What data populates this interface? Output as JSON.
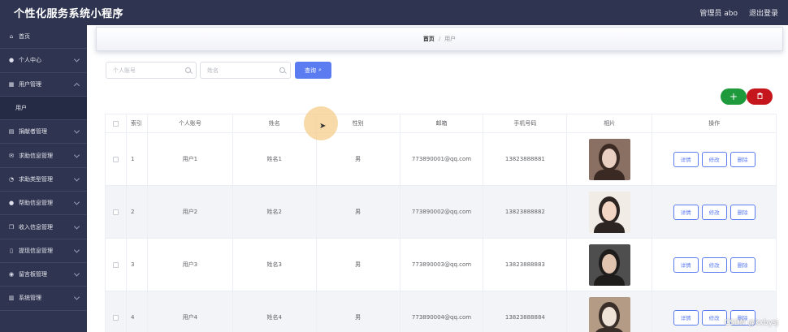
{
  "app": {
    "title": "个性化服务系统小程序"
  },
  "header": {
    "user_label": "管理员 abo",
    "logout": "退出登录"
  },
  "sidebar": {
    "items": [
      {
        "label": "首页",
        "icon": "home-icon",
        "glyph": "⌂"
      },
      {
        "label": "个人中心",
        "icon": "user-icon",
        "glyph": "●"
      },
      {
        "label": "用户管理",
        "icon": "building-icon",
        "glyph": "▦",
        "expanded": true
      },
      {
        "label": "捐献者管理",
        "icon": "grid-icon",
        "glyph": "▤"
      },
      {
        "label": "求助信息管理",
        "icon": "mail-icon",
        "glyph": "✉"
      },
      {
        "label": "求助类型管理",
        "icon": "compass-icon",
        "glyph": "◔"
      },
      {
        "label": "帮助信息管理",
        "icon": "person-icon",
        "glyph": "●"
      },
      {
        "label": "收入信息管理",
        "icon": "copy-icon",
        "glyph": "❐"
      },
      {
        "label": "提现信息管理",
        "icon": "phone-icon",
        "glyph": "▯"
      },
      {
        "label": "留言板管理",
        "icon": "pin-icon",
        "glyph": "◉"
      },
      {
        "label": "系统管理",
        "icon": "chart-icon",
        "glyph": "▥"
      }
    ],
    "sub_item": "用户"
  },
  "breadcrumb": {
    "home": "首页",
    "separator": "/",
    "current": "用户"
  },
  "search": {
    "account_placeholder": "个人账号",
    "name_placeholder": "姓名",
    "query_label": "查询"
  },
  "actions": {
    "add_glyph": "+",
    "delete_glyph": "🗑"
  },
  "table": {
    "headers": [
      "",
      "索引",
      "个人账号",
      "姓名",
      "性别",
      "邮箱",
      "手机号码",
      "相片",
      "操作"
    ],
    "op_labels": [
      "详情",
      "修改",
      "删除"
    ],
    "rows": [
      {
        "index": "1",
        "account": "用户1",
        "name": "姓名1",
        "gender": "男",
        "email": "773890001@qq.com",
        "phone": "13823888881",
        "photo_colors": [
          "#8a6f63",
          "#e8cfc2",
          "#3b2a24"
        ]
      },
      {
        "index": "2",
        "account": "用户2",
        "name": "姓名2",
        "gender": "男",
        "email": "773890002@qq.com",
        "phone": "13823888882",
        "photo_colors": [
          "#f1ece6",
          "#f3d6c4",
          "#2d2522"
        ]
      },
      {
        "index": "3",
        "account": "用户3",
        "name": "姓名3",
        "gender": "男",
        "email": "773890003@qq.com",
        "phone": "13823888883",
        "photo_colors": [
          "#4e4e4e",
          "#e0c4b0",
          "#1f1c1c"
        ]
      },
      {
        "index": "4",
        "account": "用户4",
        "name": "姓名4",
        "gender": "男",
        "email": "773890004@qq.com",
        "phone": "13823888884",
        "photo_colors": [
          "#b39b86",
          "#efe3d8",
          "#3a2e28"
        ]
      }
    ]
  },
  "watermark": "CSDN @kxbysj"
}
